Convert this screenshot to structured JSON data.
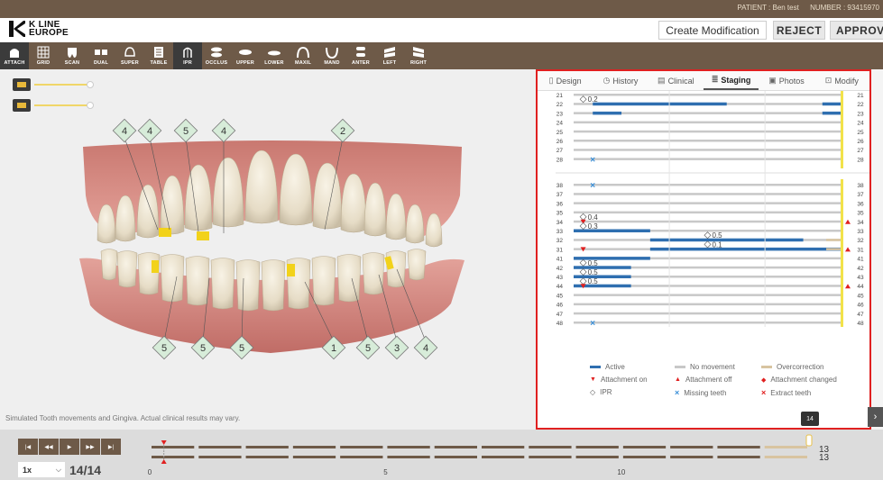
{
  "patient": {
    "name": "PATIENT : Ben test",
    "number": "NUMBER : 93415970"
  },
  "logo": {
    "line1": "K LINE",
    "line2": "EUROPE"
  },
  "header": {
    "create": "Create Modification",
    "reject": "REJECT",
    "approve": "APPROVE"
  },
  "toolbar": [
    {
      "label": "ATTACH",
      "icon": "attach-icon",
      "active": true
    },
    {
      "label": "GRID",
      "icon": "grid-icon"
    },
    {
      "label": "SCAN",
      "icon": "scan-icon"
    },
    {
      "label": "DUAL",
      "icon": "dual-icon"
    },
    {
      "label": "SUPER",
      "icon": "super-icon"
    },
    {
      "label": "TABLE",
      "icon": "table-icon"
    },
    {
      "label": "IPR",
      "icon": "ipr-icon",
      "active": true
    },
    {
      "label": "OCCLUS",
      "icon": "occlus-icon"
    },
    {
      "label": "UPPER",
      "icon": "upper-icon"
    },
    {
      "label": "LOWER",
      "icon": "lower-icon"
    },
    {
      "label": "MAXIL",
      "icon": "maxil-icon"
    },
    {
      "label": "MAND",
      "icon": "mand-icon"
    },
    {
      "label": "ANTER",
      "icon": "anter-icon"
    },
    {
      "label": "LEFT",
      "icon": "left-icon"
    },
    {
      "label": "RIGHT",
      "icon": "right-icon"
    }
  ],
  "disclaimer": "Simulated Tooth movements and Gingiva. Actual clinical results may vary.",
  "upper_markers": [
    "4",
    "4",
    "5",
    "4",
    "2"
  ],
  "lower_markers": [
    "5",
    "5",
    "5",
    "1",
    "5",
    "3",
    "4"
  ],
  "tabs": [
    {
      "label": "Design",
      "icon": "design-icon"
    },
    {
      "label": "History",
      "icon": "history-icon"
    },
    {
      "label": "Clinical",
      "icon": "clinical-icon"
    },
    {
      "label": "Staging",
      "icon": "staging-icon",
      "active": true
    },
    {
      "label": "Photos",
      "icon": "photos-icon"
    },
    {
      "label": "Modify",
      "icon": "modify-icon"
    }
  ],
  "staging": {
    "upper_rows": [
      {
        "tooth": "21"
      },
      {
        "tooth": "22",
        "ipr": "0.2",
        "active_segments": [
          [
            1,
            8
          ],
          [
            13,
            14
          ]
        ]
      },
      {
        "tooth": "23",
        "active_segments": [
          [
            1,
            2.5
          ],
          [
            13,
            14
          ]
        ]
      },
      {
        "tooth": "24"
      },
      {
        "tooth": "25"
      },
      {
        "tooth": "26"
      },
      {
        "tooth": "27"
      },
      {
        "tooth": "28",
        "missing": true
      }
    ],
    "lower_rows": [
      {
        "tooth": "38",
        "missing": true
      },
      {
        "tooth": "37"
      },
      {
        "tooth": "36"
      },
      {
        "tooth": "35"
      },
      {
        "tooth": "34",
        "ipr": "0.4",
        "attachment_on": true,
        "attachment_off": true
      },
      {
        "tooth": "33",
        "ipr": "0.3",
        "active_segments": [
          [
            0,
            4
          ]
        ]
      },
      {
        "tooth": "32",
        "ipr": "0.5",
        "ipr_stage": 7,
        "active_segments": [
          [
            4,
            12
          ]
        ]
      },
      {
        "tooth": "31",
        "ipr": "0.1",
        "ipr_stage": 7,
        "attachment_on": true,
        "attachment_off": true,
        "active_segments": [
          [
            4,
            14
          ]
        ]
      },
      {
        "tooth": "41",
        "active_segments": [
          [
            0,
            4
          ]
        ]
      },
      {
        "tooth": "42",
        "ipr": "0.5",
        "active_segments": [
          [
            0,
            3
          ]
        ]
      },
      {
        "tooth": "43",
        "ipr": "0.5",
        "active_segments": [
          [
            0,
            3
          ]
        ]
      },
      {
        "tooth": "44",
        "ipr": "0.5",
        "attachment_on": true,
        "attachment_off": true,
        "active_segments": [
          [
            0,
            3
          ]
        ]
      },
      {
        "tooth": "45"
      },
      {
        "tooth": "46"
      },
      {
        "tooth": "47"
      },
      {
        "tooth": "48",
        "missing": true
      }
    ],
    "stage_count": 14
  },
  "legend": {
    "active": "Active",
    "no_movement": "No movement",
    "overcorrection": "Overcorrection",
    "attachment_on": "Attachment on",
    "attachment_off": "Attachment off",
    "attachment_changed": "Attachment changed",
    "ipr": "IPR",
    "missing": "Missing teeth",
    "extract": "Extract teeth"
  },
  "colors": {
    "active": "#2f6fb0",
    "no_movement": "#c8c8c8",
    "overcorrection": "#d8c4a0",
    "current_stage": "#f2e24a",
    "red": "#e02020",
    "brown": "#6e5a48"
  },
  "page_indicator": "14",
  "timeline": {
    "speed": "1x",
    "step": "14/14",
    "ticks": [
      "0",
      "5",
      "10"
    ],
    "end_upper": "13",
    "end_lower": "13",
    "stages": 14
  }
}
